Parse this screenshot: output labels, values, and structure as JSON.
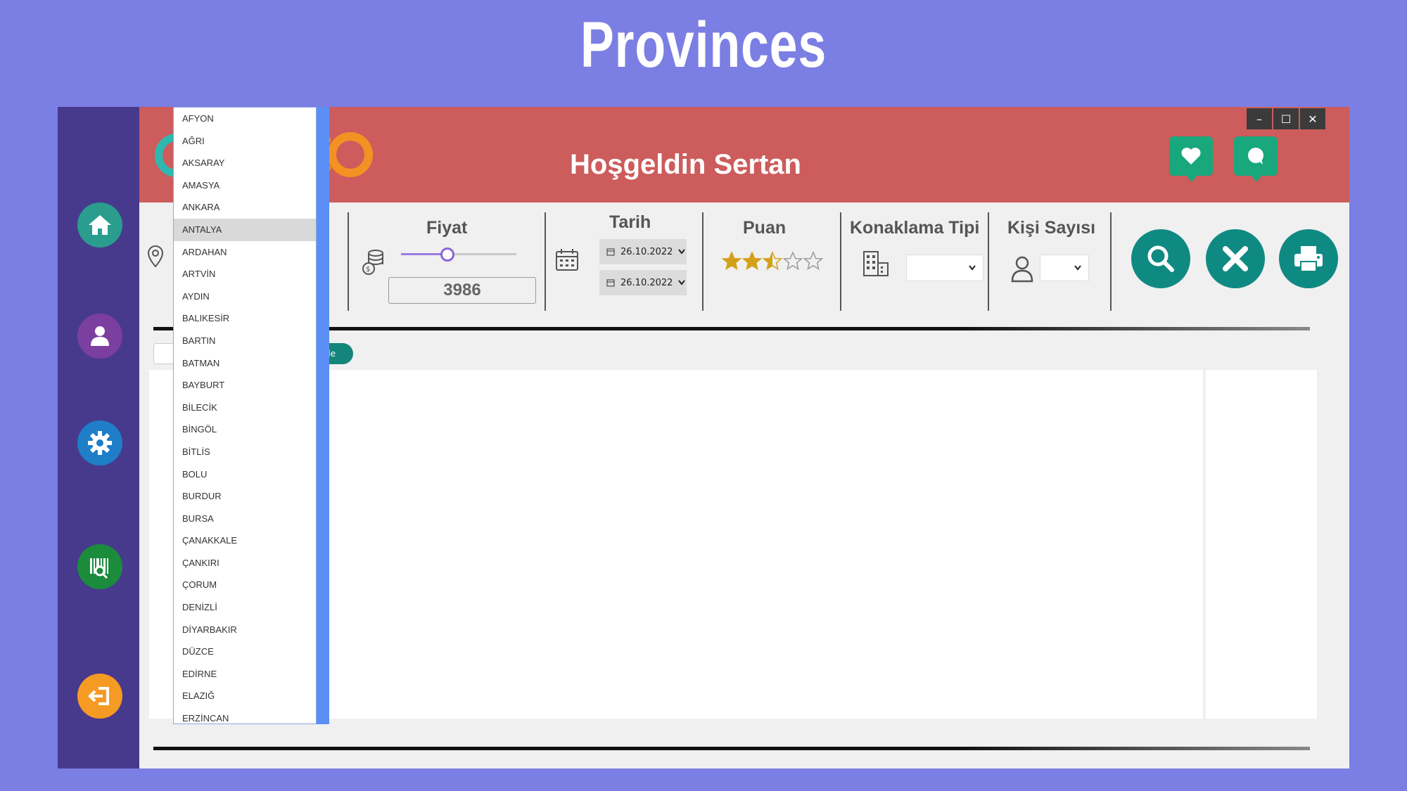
{
  "slide_title": "Provinces",
  "header": {
    "welcome": "Hoşgeldin Sertan"
  },
  "window_controls": {
    "minimize": "–",
    "maximize": "☐",
    "close": "✕"
  },
  "filters": {
    "price_label": "Fiyat",
    "price_value": "3986",
    "price_slider_fraction": 0.4,
    "date_label": "Tarih",
    "date_start": "26.10.2022",
    "date_end": "26.10.2022",
    "rating_label": "Puan",
    "rating_stars": 2.5,
    "rating_max": 5,
    "accommodation_label": "Konaklama Tipi",
    "people_label": "Kişi Sayısı"
  },
  "search_partial": "de",
  "provinces": {
    "selected": "ANTALYA",
    "items": [
      "AFYON",
      "AĞRI",
      "AKSARAY",
      "AMASYA",
      "ANKARA",
      "ANTALYA",
      "ARDAHAN",
      "ARTVİN",
      "AYDIN",
      "BALIKESİR",
      "BARTIN",
      "BATMAN",
      "BAYBURT",
      "BİLECİK",
      "BİNGÖL",
      "BİTLİS",
      "BOLU",
      "BURDUR",
      "BURSA",
      "ÇANAKKALE",
      "ÇANKIRI",
      "ÇORUM",
      "DENİZLİ",
      "DİYARBAKIR",
      "DÜZCE",
      "EDİRNE",
      "ELAZIĞ",
      "ERZİNCAN"
    ]
  },
  "colors": {
    "background": "#7b7ee2",
    "sidebar": "#473a8c",
    "header": "#cd5c5c",
    "action_button": "#0f8a83",
    "header_icon": "#19a77c",
    "star": "#d4a017",
    "home_icon_bg": "#2a9d8f",
    "user_icon_bg": "#7b3fa0",
    "settings_icon_bg": "#1e7ec8",
    "barcode_icon_bg": "#1a8c3c",
    "logout_icon_bg": "#f59a23"
  },
  "icons": {
    "sidebar": [
      "home-icon",
      "user-icon",
      "gear-icon",
      "barcode-search-icon",
      "logout-icon"
    ],
    "header": [
      "heart-icon",
      "chat-icon"
    ],
    "actions": [
      "search-icon",
      "close-icon",
      "printer-icon"
    ]
  }
}
